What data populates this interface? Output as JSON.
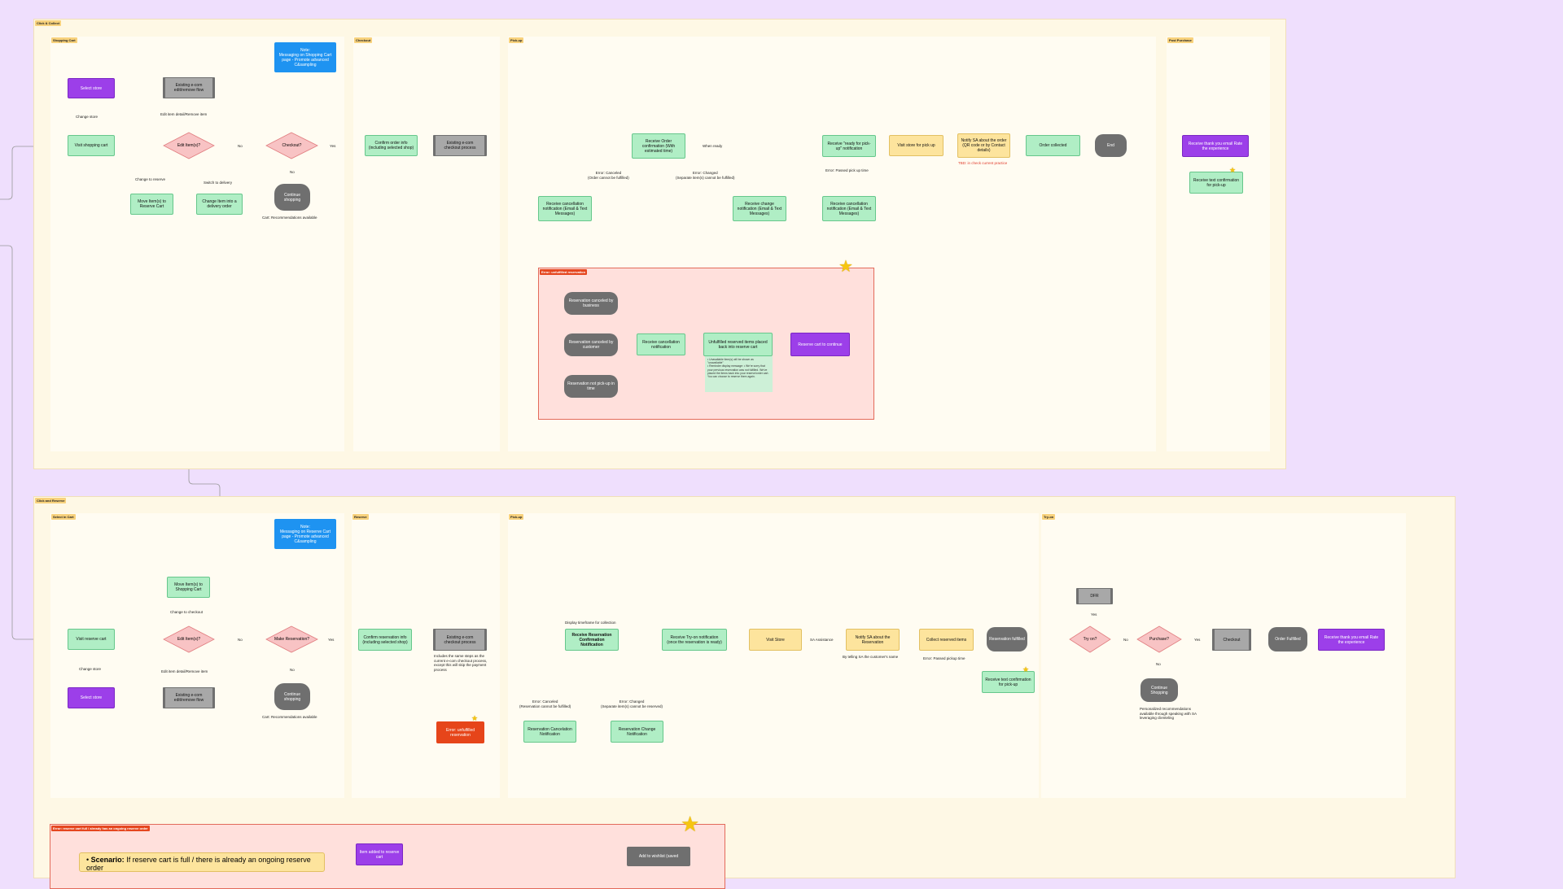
{
  "top": {
    "title": "Click & Collect",
    "lanes": {
      "cart": "Shopping Cart",
      "checkout": "Checkout",
      "pickup": "Pick-up",
      "post": "Post Purchase"
    },
    "note": "Note:\nMessaging on Shopping Cart page - Promote advanced C&sampling",
    "nodes": {
      "select_store": "Select store",
      "existing_edit": "Existing e-com edit/remove flow",
      "visit_cart": "Visit shopping cart",
      "move_reserve": "Move Item(s) to Reserve Cart",
      "change_delivery": "Change Item into a delivery order",
      "continue_shopping": "Continue shopping",
      "confirm_order": "Confirm order info (including selected shop)",
      "existing_checkout": "Existing e-com checkout process",
      "receive_order_conf": "Receive Order confirmation (With estimated time)",
      "recv_cancel_1": "Receive cancellation notification (Email & Text Messages)",
      "recv_change": "Receive change notification (Email & Text Messages)",
      "recv_ready": "Receive \"ready for pick-up\" notification",
      "recv_cancel_2": "Receive cancellation notification (Email & Text Messages)",
      "visit_store": "Visit store for pick up",
      "notify_sa": "Notify SA about the order (QR code or by Contact details)",
      "order_collected": "Order collected",
      "end": "End",
      "thank_you": "Receive thank you email Rate the experience",
      "text_conf": "Receive text confirmation for pick-up"
    },
    "diamonds": {
      "edit": "Edit Item(s)?",
      "checkout": "Checkout?"
    },
    "labels": {
      "change_store": "Change store",
      "edit_detail": "Edit item detail/Remove item",
      "no": "No",
      "yes": "Yes",
      "change_reserve": "Change to reserve",
      "switch_delivery": "Switch to delivery",
      "cart_reco": "Cart: Recommendations available",
      "when_ready": "When ready",
      "err_canceled": "Error: Canceled\n(Order cannot be fulfilled)",
      "err_changed": "Error: Changed\n(Separate item(s) cannot be fulfilled)",
      "err_passed": "Error: Passed pick up time",
      "tbd": "TBD: in check current practice"
    },
    "error_group": {
      "title": "Error: unfulfilled reservation",
      "nodes": {
        "by_business": "Reservation canceled by business",
        "by_customer": "Reservation canceled by customer",
        "not_picked": "Reservation not pick-up in time",
        "recv_cancel": "Receive cancellation notification",
        "unfulfilled": "Unfulfilled reserved items placed back into reserve cart",
        "reserve_continue": "Reserve cart to continue"
      },
      "note": "• Unavailable item(s) will be shown as \"unavailable\"\n• Reminder display message: • We're sorry that your previous reservation was not fulfilled. We've placed the items back into your reserve/order cart. You can choose to reserve them again."
    }
  },
  "bottom": {
    "title": "Click and Reserve",
    "lanes": {
      "cart": "Select in Cart",
      "reserve": "Reserve",
      "pickup": "Pick-up",
      "tryon": "Try-on"
    },
    "note": "Note:\nMessaging on Reserve Cart page - Promote advanced C&sampling",
    "nodes": {
      "move_shopping": "Move Item(s) to Shopping Cart",
      "visit_reserve": "Visit reserve cart",
      "select_store": "Select store",
      "existing_edit": "Existing e-com edit/remove flow",
      "continue_shopping": "Continue shopping",
      "confirm_reservation": "Confirm reservation info (including selected shop)",
      "existing_checkout": "Existing e-com checkout process",
      "recv_res_conf": "Receive Reservation Confirmation Notification",
      "recv_tryon": "Receive Try-on notification (once the reservation is ready)",
      "visit_store": "Visit Store",
      "notify_sa": "Notify SA about the Reservation",
      "collect_items": "Collect reserved items",
      "res_fulfilled": "Reservation fulfilled",
      "text_conf": "Receive text confirmation for pick-up",
      "res_cancel_notif": "Reservation Cancelation Notification",
      "res_change_notif": "Reservation Change Notification",
      "err_unfulfilled": "Error: unfulfilled reservation",
      "dfr": "DFR",
      "checkout": "Checkout",
      "order_fulfilled": "Order Fulfilled",
      "thank_you": "Receive thank you email Rate the experience",
      "continue_shopping2": "Continue Shopping"
    },
    "diamonds": {
      "edit": "Edit Item(s)?",
      "make": "Make Reservation?",
      "tryon": "Try on?",
      "purchase": "Purchase?"
    },
    "labels": {
      "change_checkout": "Change to checkout",
      "change_store": "Change store",
      "edit_detail": "Edit item detail/Remove item",
      "no": "No",
      "yes": "Yes",
      "cart_reco": "Cart: Recommendations available",
      "includes_same": "Includes the same steps as the current e-com checkout process, except this will skip the payment process",
      "display_timeframe": "Display timeframe for collection",
      "sa_assist": "SA Assistance",
      "by_telling": "By telling SA the customer's name",
      "err_passed": "Error: Passed pickup time",
      "err_canceled": "Error: Canceled\n(Reservation cannot be fulfilled)",
      "err_changed": "Error: Changed\n(Separate item(s) cannot be reserved)",
      "personalized": "Personalized recommendations available through speaking with SA leveraging clienteling"
    }
  },
  "error2": {
    "title": "Error: reserve cart full / already has an ongoing reserve order",
    "scenario_label": "Scenario:",
    "scenario_text": "If reserve cart is full / there is already an ongoing reserve order",
    "item_added": "Item added to reserve cart",
    "add_wishlist": "Add to wishlist (saved"
  }
}
